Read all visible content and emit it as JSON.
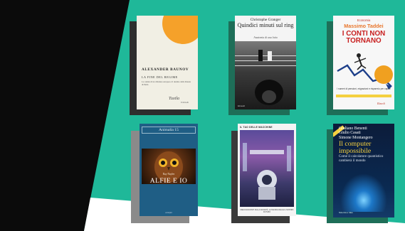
{
  "colors": {
    "black_panel": "#0b0b0b",
    "teal_panel": "#1fb899",
    "white": "#ffffff",
    "cover1_accent": "#f5a12a",
    "cover3_title": "#c81e1e",
    "cover4_bg": "#1f5e85",
    "cover6_title": "#f4d03f"
  },
  "books": [
    {
      "author": "ALEXANDER BAUNOV",
      "title": "LA FINE DEL REGIME",
      "subtitle": "La caduta di tre dittature europee e il destino della Russia di Putin",
      "signature": "Tuxtla",
      "publisher": "Feltrinelli"
    },
    {
      "author": "Christophe Granger",
      "title": "Quindici minuti sul ring",
      "subtitle": "Anatomia di una lotta",
      "publisher": "Einaudi"
    },
    {
      "series": "Economia",
      "author": "Massimo Taddei",
      "title": "I CONTI NON TORNANO",
      "tagline": "I numeri di pensioni, migrazioni e risparmio per capire",
      "publisher": "Rizzoli"
    },
    {
      "series": "Animalia 15",
      "author": "Ray Nayler",
      "title": "ALFIE E IO",
      "publisher": "Adelphi"
    },
    {
      "label": "IL TAO DELLE MACCHINE",
      "bottom": "DIECI RACCONTI SULLA SOCIETÀ, LA TECNOLOGIA E IL NOSTRO FUTURO"
    },
    {
      "authors": [
        "Giuliano Benenti",
        "Giulio Casati",
        "Simone Montangero"
      ],
      "title": "Il computer impossibile",
      "subtitle": "Come il calcolatore quantistico cambierà il mondo",
      "publisher": "Scienza e Idee"
    }
  ]
}
